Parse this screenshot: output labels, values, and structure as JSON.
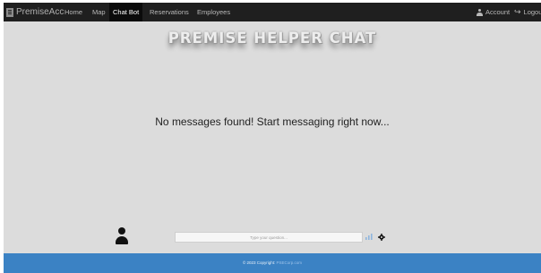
{
  "navbar": {
    "brand": "PremiseAcc",
    "links": [
      "Home",
      "Map",
      "Chat Bot",
      "Reservations",
      "Employees"
    ],
    "active_link": "Chat Bot",
    "account_label": "Account",
    "logout_label": "Logout"
  },
  "main": {
    "title": "PREMISE HELPER CHAT",
    "empty_message": "No messages found! Start messaging right now...",
    "input_placeholder": "Type your question..."
  },
  "footer": {
    "copyright": "© 2023 Copyright:",
    "link_text": "PSECorp.com"
  },
  "colors": {
    "navbar_bg": "#1f1f1f",
    "page_bg": "#dcdcdc",
    "footer_bg": "#3b82c4",
    "send_icon": "#8fb6de"
  },
  "icons": [
    "document-icon",
    "user-icon",
    "logout-icon",
    "avatar-icon",
    "send-icon",
    "gear-icon"
  ]
}
